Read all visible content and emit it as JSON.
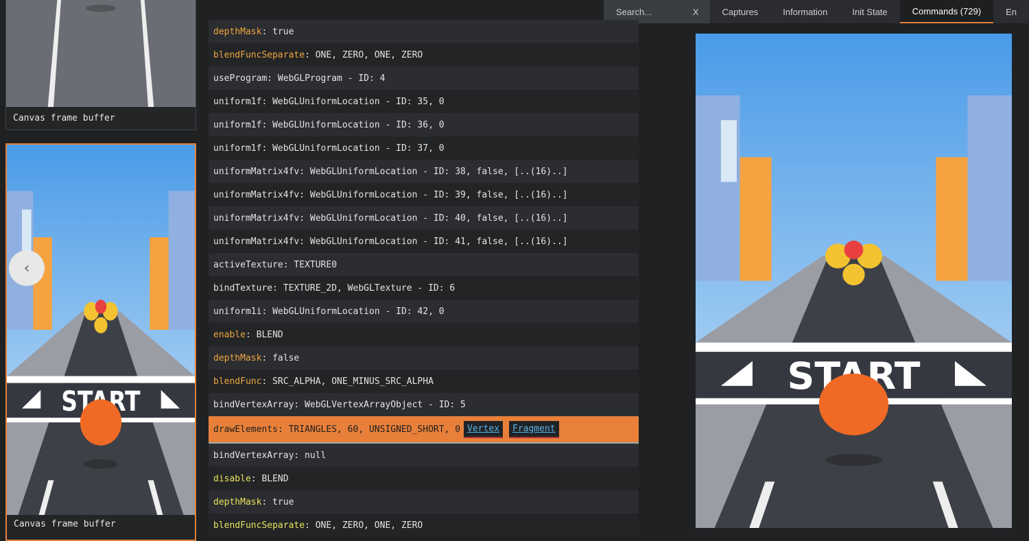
{
  "topbar": {
    "search_placeholder": "Search...",
    "search_clear": "X",
    "tabs": [
      {
        "label": "Captures"
      },
      {
        "label": "Information"
      },
      {
        "label": "Init State"
      },
      {
        "label": "Commands (729)",
        "active": true
      },
      {
        "label": "En"
      }
    ]
  },
  "thumbnails": [
    {
      "caption": "Canvas frame buffer"
    },
    {
      "caption": "Canvas frame buffer",
      "selected": true
    }
  ],
  "prev_icon": "chevron-left-icon",
  "game_image_lettering": "START",
  "commands": [
    {
      "name": "depthMask",
      "args": ": true",
      "color": "orange"
    },
    {
      "name": "blendFuncSeparate",
      "args": ": ONE, ZERO, ONE, ZERO",
      "color": "orange"
    },
    {
      "name": "useProgram",
      "args": ": WebGLProgram - ID: 4"
    },
    {
      "name": "uniform1f",
      "args": ": WebGLUniformLocation - ID: 35, 0"
    },
    {
      "name": "uniform1f",
      "args": ": WebGLUniformLocation - ID: 36, 0"
    },
    {
      "name": "uniform1f",
      "args": ": WebGLUniformLocation - ID: 37, 0"
    },
    {
      "name": "uniformMatrix4fv",
      "args": ": WebGLUniformLocation - ID: 38, false, [..(16)..]"
    },
    {
      "name": "uniformMatrix4fv",
      "args": ": WebGLUniformLocation - ID: 39, false, [..(16)..]"
    },
    {
      "name": "uniformMatrix4fv",
      "args": ": WebGLUniformLocation - ID: 40, false, [..(16)..]"
    },
    {
      "name": "uniformMatrix4fv",
      "args": ": WebGLUniformLocation - ID: 41, false, [..(16)..]"
    },
    {
      "name": "activeTexture",
      "args": ": TEXTURE0"
    },
    {
      "name": "bindTexture",
      "args": ": TEXTURE_2D, WebGLTexture - ID: 6"
    },
    {
      "name": "uniform1i",
      "args": ": WebGLUniformLocation - ID: 42, 0"
    },
    {
      "name": "enable",
      "args": ": BLEND",
      "color": "orange"
    },
    {
      "name": "depthMask",
      "args": ": false",
      "color": "orange"
    },
    {
      "name": "blendFunc",
      "args": ": SRC_ALPHA, ONE_MINUS_SRC_ALPHA",
      "color": "orange"
    },
    {
      "name": "bindVertexArray",
      "args": ": WebGLVertexArrayObject - ID: 5"
    },
    {
      "name": "drawElements",
      "args": ": TRIANGLES, 60, UNSIGNED_SHORT, 0",
      "highlighted": true,
      "links": [
        "Vertex",
        "Fragment"
      ]
    },
    {
      "name": "bindVertexArray",
      "args": ": null"
    },
    {
      "name": "disable",
      "args": ": BLEND",
      "color": "yellow"
    },
    {
      "name": "depthMask",
      "args": ": true",
      "color": "yellow"
    },
    {
      "name": "blendFuncSeparate",
      "args": ": ONE, ZERO, ONE, ZERO",
      "color": "yellow"
    }
  ],
  "colors": {
    "accent": "#e8803a",
    "orange_command": "#eea640",
    "yellow_command": "#e9e35e",
    "link": "#5fb2e6"
  }
}
